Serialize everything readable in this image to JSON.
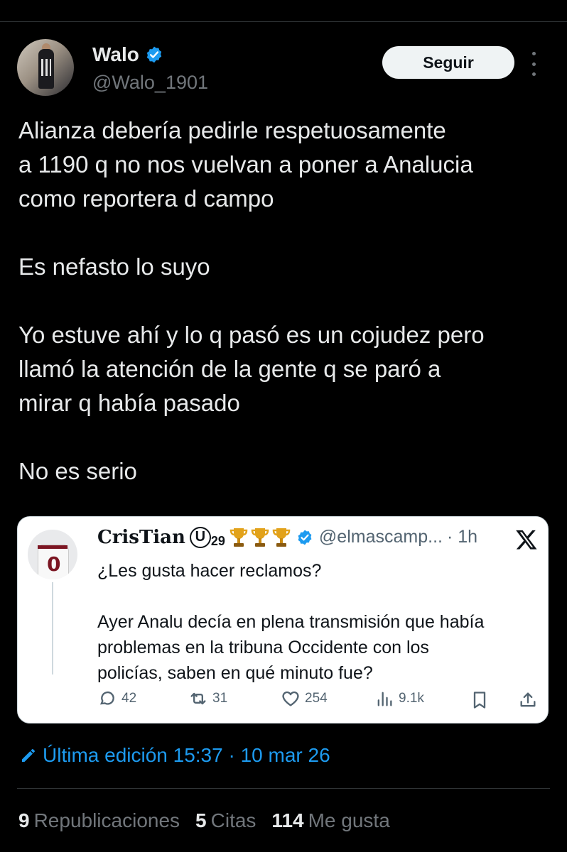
{
  "tweet": {
    "author": {
      "name": "Walo",
      "handle": "@Walo_1901"
    },
    "follow_label": "Seguir",
    "paragraphs": [
      [
        "Alianza debería pedirle respetuosamente",
        "a 1190 q no nos vuelvan a poner a Analucia",
        "como reportera d campo"
      ],
      [
        "Es nefasto lo suyo"
      ],
      [
        "Yo estuve ahí y lo q pasó es un cojudez pero",
        "llamó la atención de la gente q se paró a",
        "mirar q había pasado"
      ],
      [
        "No es serio"
      ]
    ]
  },
  "quoted": {
    "name": "CrisTian",
    "u_glyph": "U",
    "u_number": "29",
    "handle": "@elmascamp...",
    "time": "· 1h",
    "lines": [
      [
        "¿Les gusta hacer reclamos?"
      ],
      [
        "Ayer Analu decía en plena transmisión que había",
        "problemas en la tribuna Occidente con los",
        "policías, saben en qué minuto fue?"
      ]
    ],
    "avatar_number": "0",
    "actions": {
      "replies": "42",
      "reposts": "31",
      "likes": "254",
      "views": "9.1k"
    }
  },
  "edited": {
    "label": "Última edición 15:37 · 10 mar 26"
  },
  "stats": {
    "reposts_count": "9",
    "reposts_label": "Republicaciones",
    "quotes_count": "5",
    "quotes_label": "Citas",
    "likes_count": "114",
    "likes_label": "Me gusta"
  },
  "colors": {
    "accent": "#1d9bf0",
    "background": "#000000",
    "card": "#ffffff",
    "trophy": "#e2a21a"
  },
  "icons": [
    "verified-badge-icon",
    "more-icon",
    "trophy-icon",
    "x-logo-icon",
    "reply-icon",
    "repost-icon",
    "like-icon",
    "views-icon",
    "bookmark-icon",
    "share-icon",
    "edit-pencil-icon"
  ]
}
